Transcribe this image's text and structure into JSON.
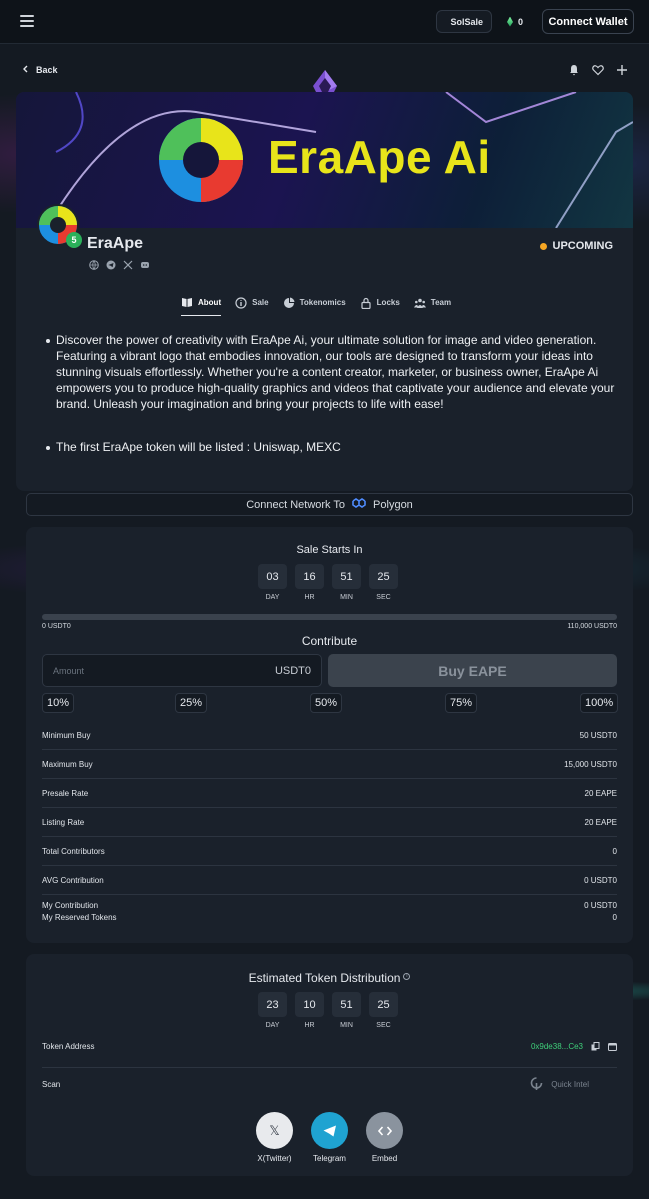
{
  "topbar": {
    "menu_icon": "hamburger-icon",
    "network_label": "SolSale",
    "count": "0",
    "connect_wallet": "Connect Wallet"
  },
  "nav": {
    "back_label": "Back",
    "icons": [
      "bell-icon",
      "heart-icon",
      "plus-icon"
    ]
  },
  "banner": {
    "title": "EraApe Ai"
  },
  "project": {
    "name": "EraApe",
    "avatar_badge": "5",
    "status": "UPCOMING",
    "status_color": "#f5a623",
    "socials": [
      "globe-icon",
      "telegram-icon",
      "x-icon",
      "discord-icon"
    ]
  },
  "tabs": [
    {
      "label": "About",
      "icon": "book-icon",
      "active": true
    },
    {
      "label": "Sale",
      "icon": "info-icon",
      "active": false
    },
    {
      "label": "Tokenomics",
      "icon": "pie-chart-icon",
      "active": false
    },
    {
      "label": "Locks",
      "icon": "lock-icon",
      "active": false
    },
    {
      "label": "Team",
      "icon": "team-icon",
      "active": false
    }
  ],
  "about": {
    "paragraphs": [
      "Discover the power of creativity with EraApe Ai, your ultimate solution for image and video generation. Featuring a vibrant logo that embodies innovation, our tools are designed to transform your ideas into stunning visuals effortlessly. Whether you're a content creator, marketer, or business owner, EraApe Ai empowers you to produce high-quality graphics and videos that captivate your audience and elevate your brand. Unleash your imagination and bring your projects to life with ease!",
      "The first EraApe token will be listed : Uniswap, MEXC"
    ]
  },
  "network_bar": {
    "prefix": "Connect Network To",
    "network": "Polygon"
  },
  "sale": {
    "countdown_title": "Sale Starts In",
    "countdown": [
      {
        "value": "03",
        "label": "DAY"
      },
      {
        "value": "16",
        "label": "HR"
      },
      {
        "value": "51",
        "label": "MIN"
      },
      {
        "value": "25",
        "label": "SEC"
      }
    ],
    "progress_fraction": 0,
    "progress_min": "0 USDT0",
    "progress_max": "110,000 USDT0",
    "contribute_title": "Contribute",
    "amount_placeholder": "Amount",
    "amount_unit": "USDT0",
    "buy_label": "Buy EAPE",
    "percent_buttons": [
      "10%",
      "25%",
      "50%",
      "75%",
      "100%"
    ],
    "rows": [
      {
        "label": "Minimum Buy",
        "value": "50 USDT0"
      },
      {
        "label": "Maximum Buy",
        "value": "15,000 USDT0"
      },
      {
        "label": "Presale Rate",
        "value": "20 EAPE"
      },
      {
        "label": "Listing Rate",
        "value": "20 EAPE"
      },
      {
        "label": "Total Contributors",
        "value": "0"
      },
      {
        "label": "AVG Contribution",
        "value": "0 USDT0"
      }
    ],
    "my_contribution_label": "My Contribution",
    "my_contribution_value": "0 USDT0",
    "my_reserved_label": "My Reserved Tokens",
    "my_reserved_value": "0"
  },
  "distribution": {
    "title": "Estimated Token Distribution",
    "countdown": [
      {
        "value": "23",
        "label": "DAY"
      },
      {
        "value": "10",
        "label": "HR"
      },
      {
        "value": "51",
        "label": "MIN"
      },
      {
        "value": "25",
        "label": "SEC"
      }
    ],
    "token_address_label": "Token Address",
    "token_address_value": "0x9de38...Ce3",
    "scan_label": "Scan",
    "scan_value": "Quick Intel",
    "share": [
      {
        "label": "X(Twitter)",
        "icon": "x-icon",
        "color": "#e8eaed"
      },
      {
        "label": "Telegram",
        "icon": "telegram-icon",
        "color": "#1fa3d1"
      },
      {
        "label": "Embed",
        "icon": "code-icon",
        "color": "#8a939e"
      }
    ]
  }
}
